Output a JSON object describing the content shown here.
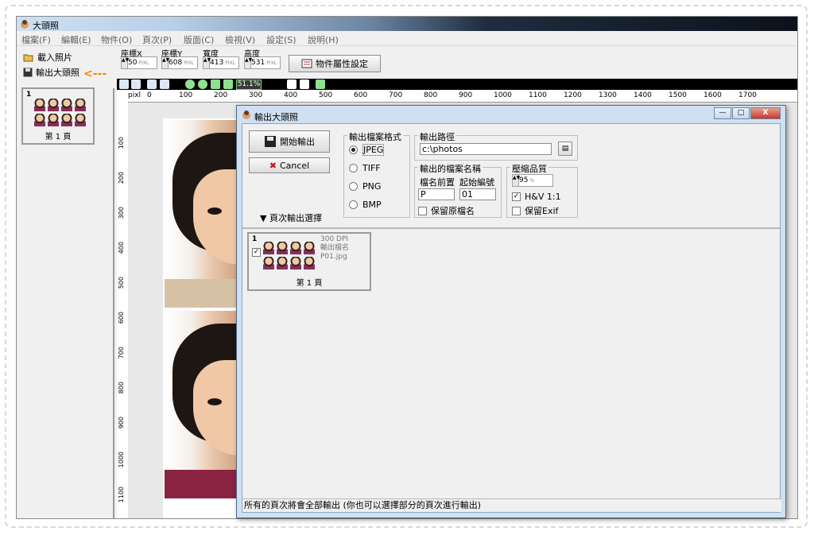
{
  "app": {
    "title": "大頭照"
  },
  "menu": [
    "檔案(F)",
    "編輯(E)",
    "物件(O)",
    "頁次(P)",
    "版面(C)",
    "檢視(V)",
    "設定(S)",
    "說明(H)"
  ],
  "left": {
    "load_label": "載入照片",
    "export_label": "輸出大頭照",
    "arrow": "<---",
    "thumb_num": "1",
    "page_label": "第 1 頁"
  },
  "toolbar": {
    "x_label": "座標X",
    "x_value": "50",
    "y_label": "座標Y",
    "y_value": "608",
    "w_label": "寬度",
    "w_value": "413",
    "h_label": "高度",
    "h_value": "531",
    "unit": "PIXL",
    "props_label": "物件屬性設定",
    "zoom": "51.1%"
  },
  "ruler_ticks": [
    "0",
    "100",
    "200",
    "300",
    "400",
    "500",
    "600",
    "700",
    "800",
    "900",
    "1000",
    "1100",
    "1200",
    "1300",
    "1400",
    "1500",
    "1600",
    "1700"
  ],
  "ruler_v": [
    "100",
    "200",
    "300",
    "400",
    "500",
    "600",
    "700",
    "800",
    "900",
    "1000",
    "1100"
  ],
  "ruler_origin": "pixl",
  "dialog": {
    "title": "輸出大頭照",
    "start_label": "開始輸出",
    "cancel_label": "Cancel",
    "format_title": "輸出檔案格式",
    "formats": [
      "JPEG",
      "TIFF",
      "PNG",
      "BMP"
    ],
    "selected_format": "JPEG",
    "path_title": "輸出路徑",
    "path_value": "c:\\photos",
    "filename_title": "輸出的檔案名稱",
    "prefix_label": "檔名前置",
    "prefix_value": "P",
    "start_num_label": "起始編號",
    "start_num_value": "01",
    "keep_name_label": "保留原檔名",
    "quality_title": "壓縮品質",
    "quality_value": "95",
    "quality_unit": "%",
    "hv_label": "H&V 1:1",
    "hv_checked": true,
    "keep_exif_label": "保留Exif",
    "page_select_label": "▼ 頁次輸出選擇",
    "thumb_num": "1",
    "thumb_info": [
      "300 DPI",
      "輸出檔名",
      "P01.jpg"
    ],
    "thumb_page": "第 1 頁",
    "status": "所有的頁次將會全部輸出 (你也可以選擇部分的頁次進行輸出)",
    "ctrl_min": "—",
    "ctrl_max": "□",
    "ctrl_close": "X"
  }
}
